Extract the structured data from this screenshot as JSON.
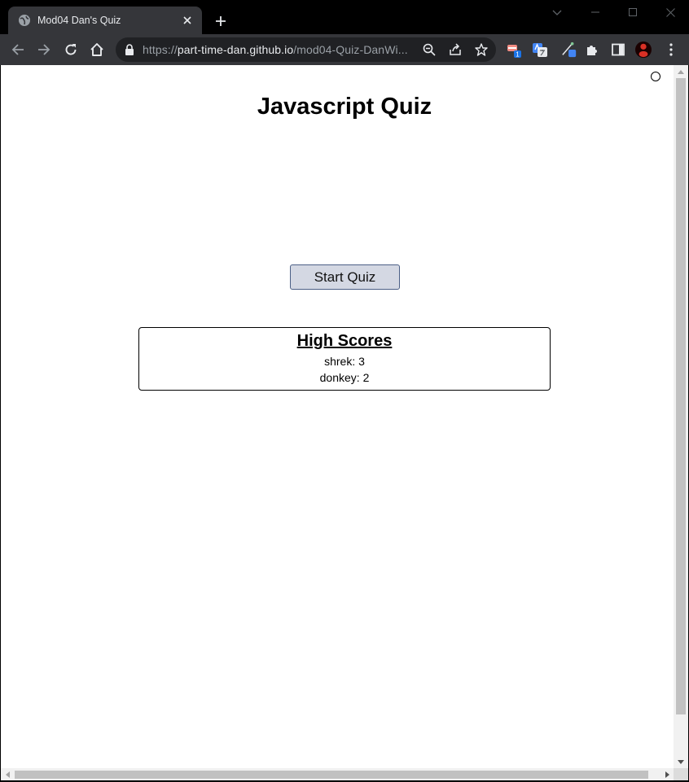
{
  "browser": {
    "tab_title": "Mod04 Dan's Quiz",
    "url_scheme": "https://",
    "url_host": "part-time-dan.github.io",
    "url_path": "/mod04-Quiz-DanWi...",
    "extension_badge": "1",
    "accent_color": "#35363a",
    "icons": [
      "globe-icon",
      "close-icon",
      "plus-icon",
      "chevron-down-icon",
      "minimize-icon",
      "maximize-icon",
      "window-close-icon",
      "back-arrow-icon",
      "forward-arrow-icon",
      "reload-icon",
      "home-icon",
      "lock-icon",
      "zoom-out-icon",
      "share-icon",
      "star-icon",
      "extension-icons",
      "puzzle-icon",
      "side-panel-icon",
      "profile-avatar",
      "kebab-menu-icon"
    ]
  },
  "page": {
    "title": "Javascript Quiz",
    "start_button": "Start Quiz",
    "high_scores": {
      "heading": "High Scores",
      "entries": [
        "shrek: 3",
        "donkey: 2"
      ]
    }
  }
}
